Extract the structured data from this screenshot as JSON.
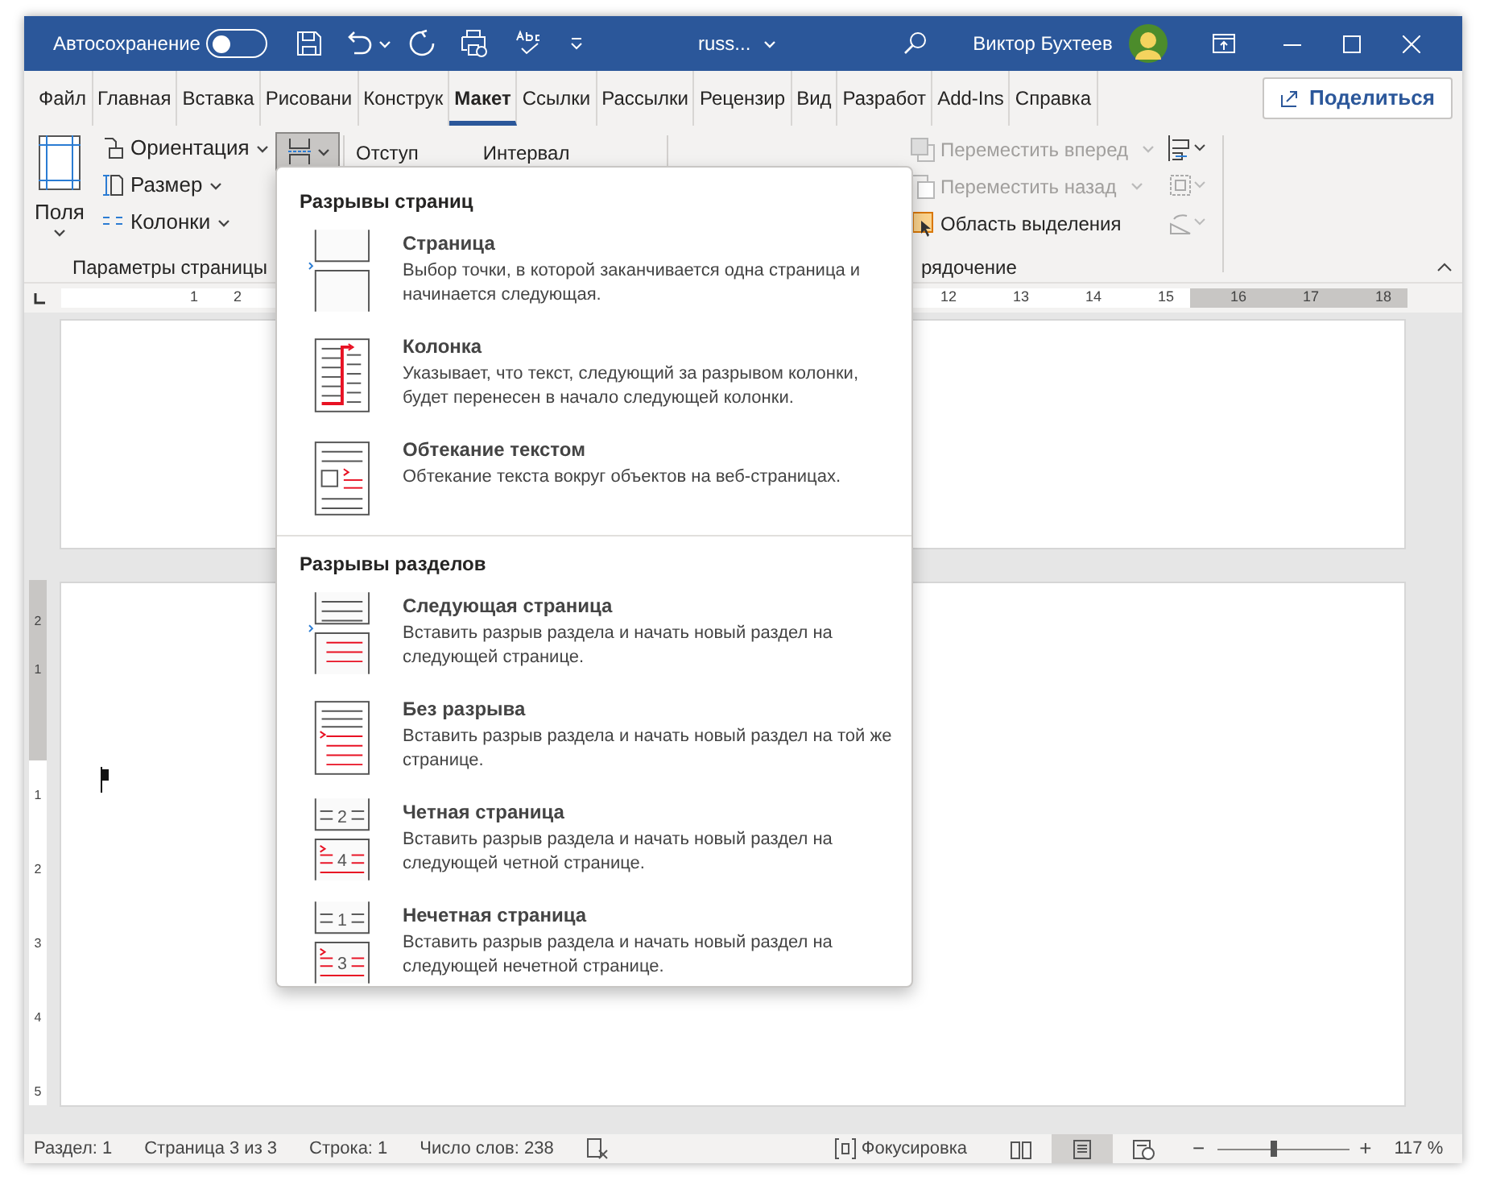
{
  "title_bar": {
    "autosave_label": "Автосохранение",
    "autosave_on": false,
    "document_name": "russ...",
    "user_name": "Виктор Бухтеев"
  },
  "tabs": [
    {
      "label": "Файл",
      "selected": false
    },
    {
      "label": "Главная",
      "selected": false
    },
    {
      "label": "Вставка",
      "selected": false
    },
    {
      "label": "Рисовани",
      "selected": false
    },
    {
      "label": "Конструк",
      "selected": false
    },
    {
      "label": "Макет",
      "selected": true
    },
    {
      "label": "Ссылки",
      "selected": false
    },
    {
      "label": "Рассылки",
      "selected": false
    },
    {
      "label": "Рецензир",
      "selected": false
    },
    {
      "label": "Вид",
      "selected": false
    },
    {
      "label": "Разработ",
      "selected": false
    },
    {
      "label": "Add-Ins",
      "selected": false
    },
    {
      "label": "Справка",
      "selected": false
    }
  ],
  "share_button": "Поделиться",
  "ribbon": {
    "page_setup": {
      "margins": "Поля",
      "orientation": "Ориентация",
      "size": "Размер",
      "columns": "Колонки",
      "breaks_open": true,
      "group_label": "Параметры страницы"
    },
    "paragraph": {
      "indent": "Отступ",
      "spacing": "Интервал"
    },
    "arrange": {
      "items": [
        {
          "label": "Переместить вперед",
          "disabled": true,
          "kind": "forward"
        },
        {
          "label": "Переместить назад",
          "disabled": true,
          "kind": "backward"
        },
        {
          "label": "Область выделения",
          "disabled": false,
          "kind": "pane"
        }
      ],
      "group_label": "рядочение"
    }
  },
  "ruler": {
    "left_numbers": [
      "1",
      "2"
    ],
    "right_numbers": [
      "12",
      "13",
      "14",
      "15",
      "16",
      "17",
      "18"
    ],
    "vertical_numbers": [
      "2",
      "1",
      "1",
      "2",
      "3",
      "4",
      "5"
    ]
  },
  "breaks_menu": {
    "sections": [
      {
        "title": "Разрывы страниц",
        "items": [
          {
            "kind": "page",
            "label": "Страница",
            "description": "Выбор точки, в которой заканчивается одна страница и начинается следующая."
          },
          {
            "kind": "column",
            "label": "Колонка",
            "description": "Указывает, что текст, следующий за разрывом колонки, будет перенесен в начало следующей колонки."
          },
          {
            "kind": "wrap",
            "label": "Обтекание текстом",
            "description": "Обтекание текста вокруг объектов на веб-страницах."
          }
        ]
      },
      {
        "title": "Разрывы разделов",
        "items": [
          {
            "kind": "next",
            "label": "Следующая страница",
            "description": "Вставить разрыв раздела и начать новый раздел на следующей странице."
          },
          {
            "kind": "continuous",
            "label": "Без разрыва",
            "description": "Вставить разрыв раздела и начать новый раздел на той же странице."
          },
          {
            "kind": "numbered",
            "label": "Четная страница",
            "description": "Вставить разрыв раздела и начать новый раздел на следующей четной странице.",
            "icon_numbers": [
              "2",
              "4"
            ]
          },
          {
            "kind": "numbered",
            "label": "Нечетная страница",
            "description": "Вставить разрыв раздела и начать новый раздел на следующей нечетной странице.",
            "icon_numbers": [
              "1",
              "3"
            ]
          }
        ]
      }
    ]
  },
  "status_bar": {
    "items": [
      "Раздел: 1",
      "Страница 3 из 3",
      "Строка: 1",
      "Число слов: 238"
    ],
    "focus": "Фокусировка",
    "views": [
      {
        "kind": "read",
        "selected": false
      },
      {
        "kind": "print",
        "selected": true
      },
      {
        "kind": "web",
        "selected": false
      }
    ],
    "zoom": {
      "minus": "−",
      "plus": "+",
      "level": 0.42,
      "reading": "117 %"
    }
  }
}
